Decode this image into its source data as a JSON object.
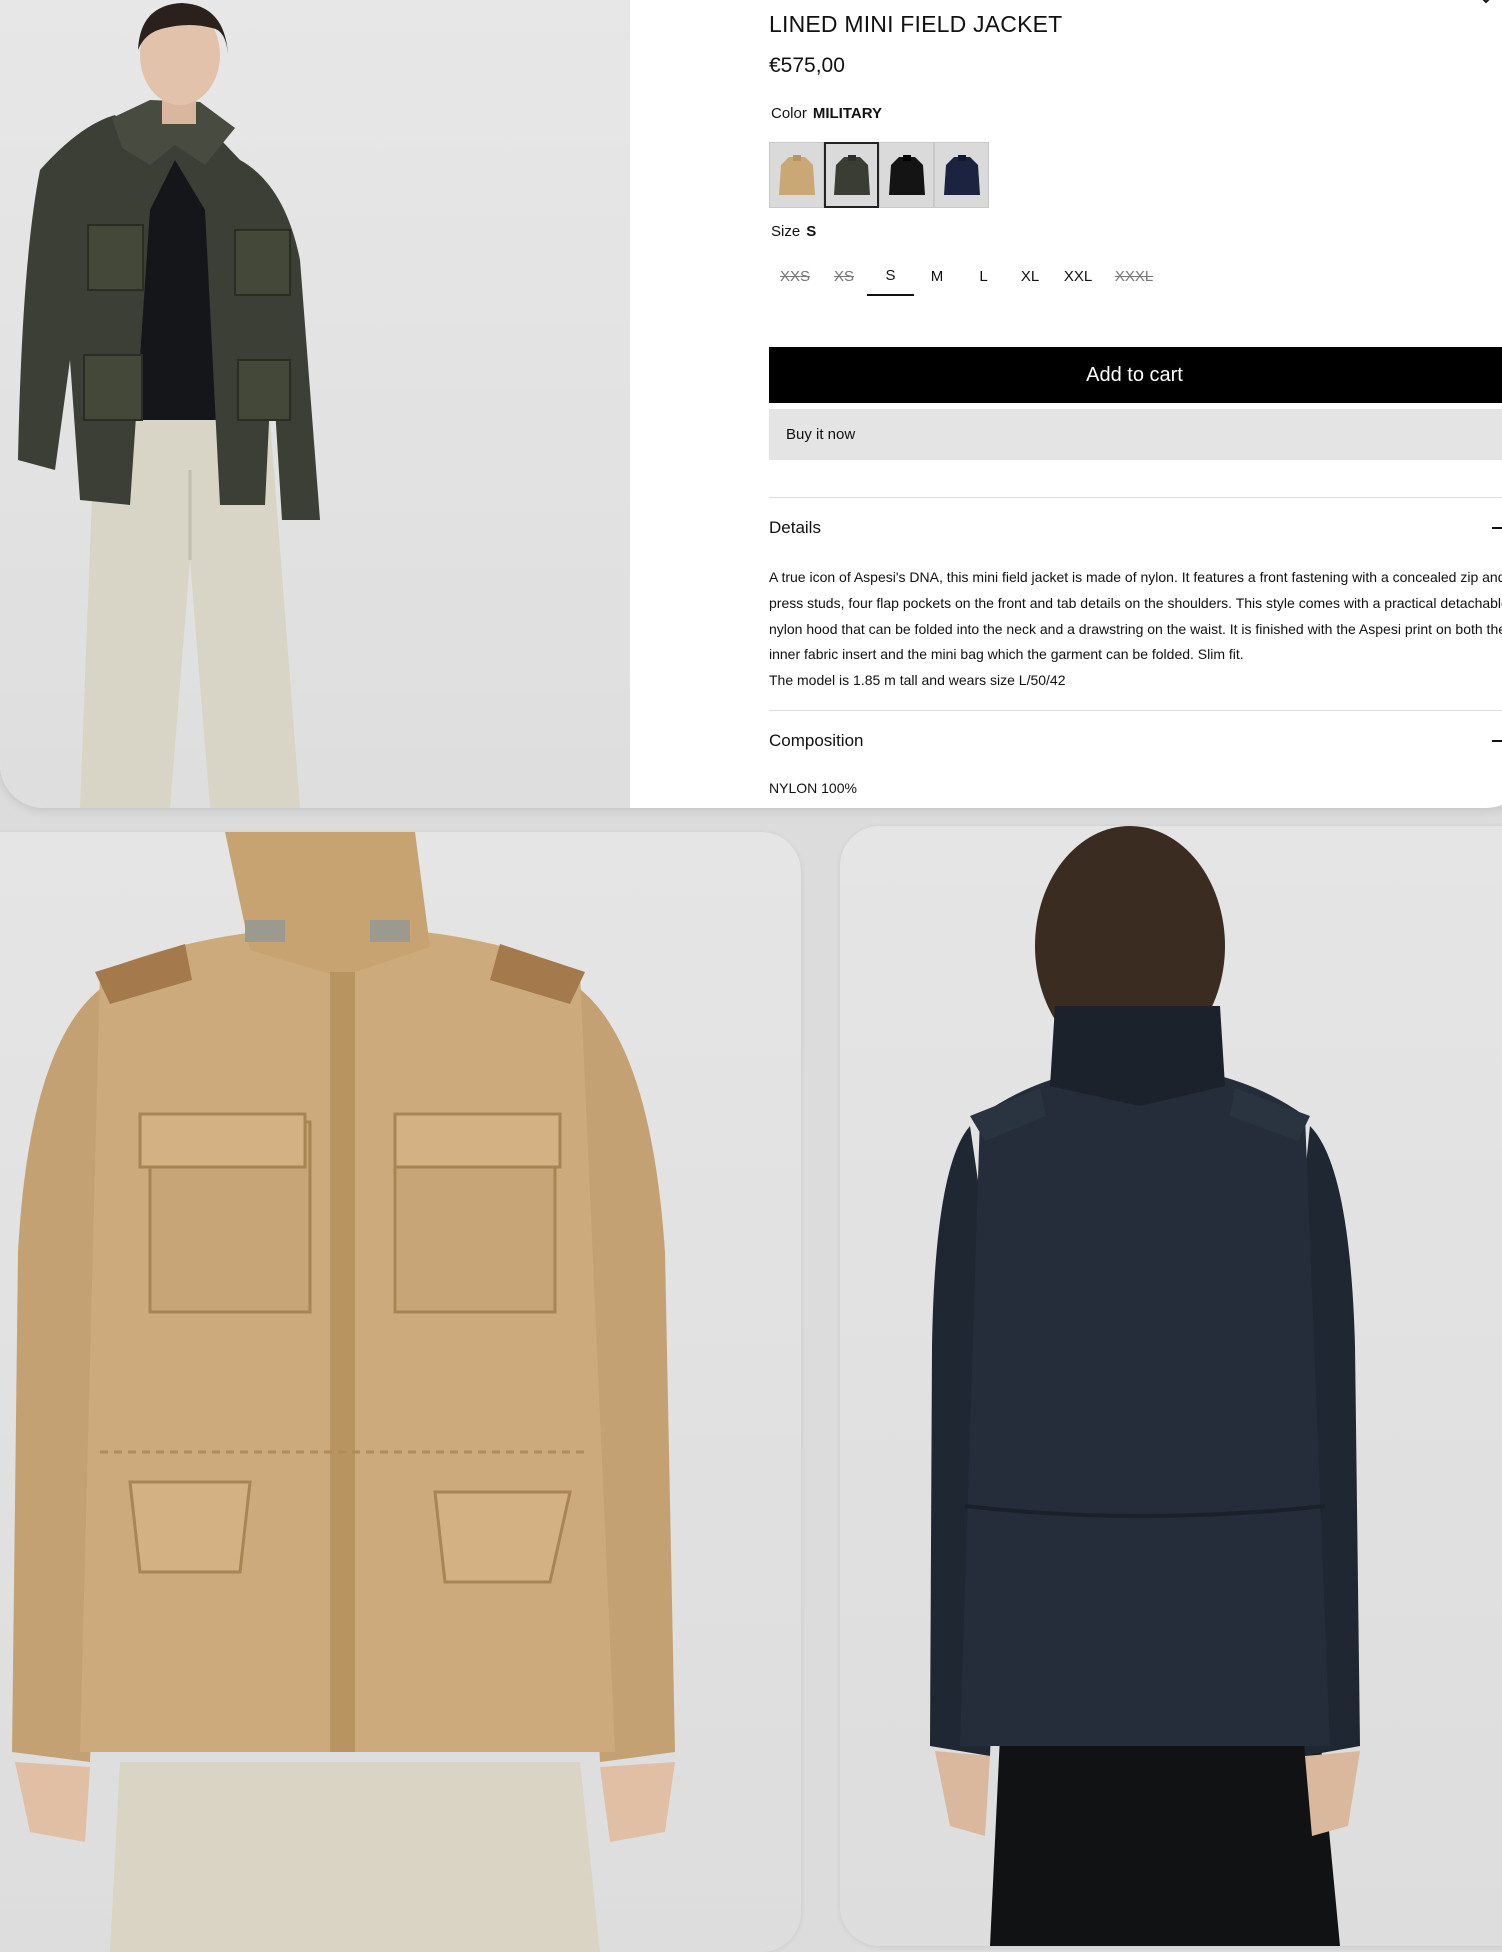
{
  "product": {
    "title": "LINED MINI FIELD JACKET",
    "price": "€575,00"
  },
  "color": {
    "label": "Color",
    "selected": "MILITARY",
    "swatches": [
      {
        "name": "beige",
        "hex": "#c9a876"
      },
      {
        "name": "military",
        "hex": "#3a3d34"
      },
      {
        "name": "black",
        "hex": "#141414"
      },
      {
        "name": "navy",
        "hex": "#1c2340"
      }
    ]
  },
  "size": {
    "label": "Size",
    "selected": "S",
    "options": [
      {
        "label": "XXS",
        "available": false
      },
      {
        "label": "XS",
        "available": false
      },
      {
        "label": "S",
        "available": true,
        "selected": true
      },
      {
        "label": "M",
        "available": true
      },
      {
        "label": "L",
        "available": true
      },
      {
        "label": "XL",
        "available": true
      },
      {
        "label": "XXL",
        "available": true
      },
      {
        "label": "XXXL",
        "available": false
      }
    ]
  },
  "actions": {
    "add_to_cart": "Add to cart",
    "buy_now": "Buy it now"
  },
  "details": {
    "heading": "Details",
    "text": "A true icon of Aspesi's DNA, this mini field jacket is made of nylon. It features a front fastening with a concealed zip and press studs, four flap pockets on the front and tab details on the shoulders. This style comes with a practical detachable nylon hood that can be folded into the neck and a drawstring on the waist. It is finished with the Aspesi print on both the inner fabric insert and the mini bag which the garment can be folded. Slim fit.",
    "model_note": "The model is 1.85 m tall and wears size L/50/42"
  },
  "composition": {
    "heading": "Composition",
    "text": "NYLON 100%"
  },
  "colors": {
    "military": "#3a3d34",
    "beige": "#c9a876",
    "navy": "#1c2430",
    "button_black": "#000000",
    "button_grey": "#e4e4e4"
  }
}
